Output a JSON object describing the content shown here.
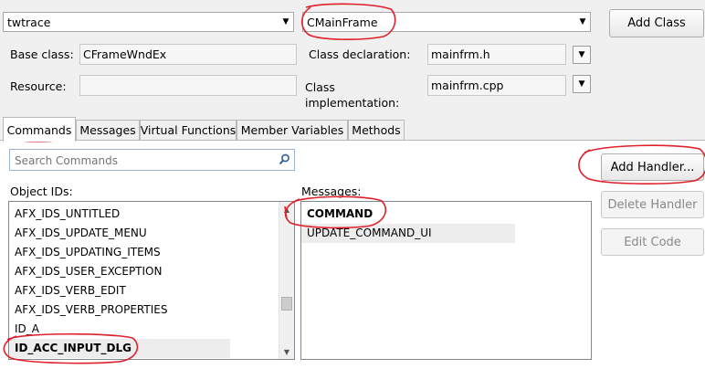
{
  "top": {
    "project_combo_value": "twtrace",
    "class_combo_value": "CMainFrame",
    "add_class_label": "Add Class"
  },
  "details": {
    "base_class_label": "Base class:",
    "base_class_value": "CFrameWndEx",
    "class_declaration_label": "Class declaration:",
    "class_declaration_value": "mainfrm.h",
    "resource_label": "Resource:",
    "resource_value": "",
    "class_implementation_label_line1": "Class",
    "class_implementation_label_line2": "implementation:",
    "class_implementation_value": "mainfrm.cpp"
  },
  "tabs": [
    {
      "label": "Commands",
      "active": true
    },
    {
      "label": "Messages"
    },
    {
      "label": "Virtual Functions"
    },
    {
      "label": "Member Variables"
    },
    {
      "label": "Methods"
    }
  ],
  "search": {
    "placeholder": "Search Commands"
  },
  "object_ids": {
    "label": "Object IDs:",
    "items": [
      "AFX_IDS_UNTITLED",
      "AFX_IDS_UPDATE_MENU",
      "AFX_IDS_UPDATING_ITEMS",
      "AFX_IDS_USER_EXCEPTION",
      "AFX_IDS_VERB_EDIT",
      "AFX_IDS_VERB_PROPERTIES",
      "ID_A",
      "ID_ACC_INPUT_DLG"
    ],
    "selected": "ID_ACC_INPUT_DLG"
  },
  "messages": {
    "label": "Messages:",
    "items": [
      "COMMAND",
      "UPDATE_COMMAND_UI"
    ],
    "bold_item": "COMMAND"
  },
  "buttons": {
    "add_handler": "Add Handler...",
    "delete_handler": "Delete Handler",
    "edit_code": "Edit Code"
  },
  "colors": {
    "annotation": "#e0202a",
    "selection": "#ededed"
  }
}
